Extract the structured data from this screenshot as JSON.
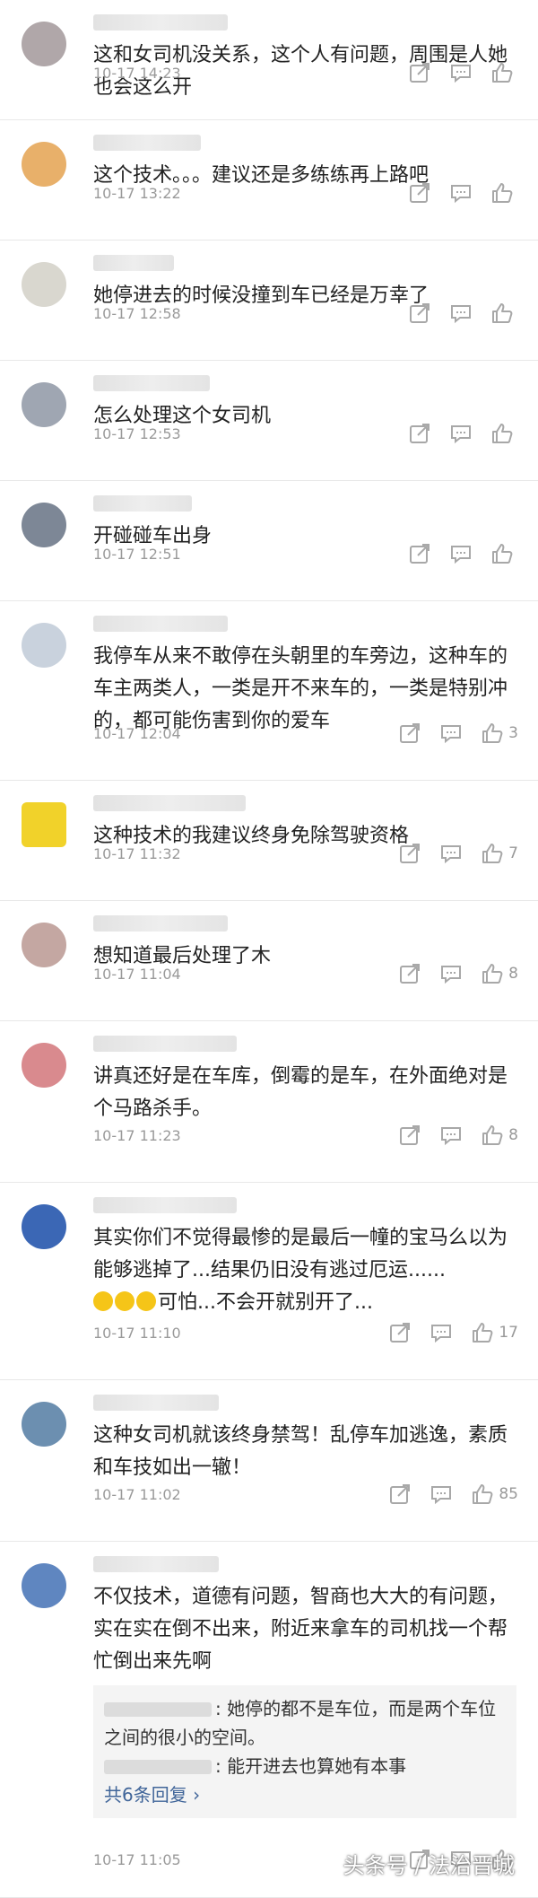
{
  "comments": [
    {
      "text": "这和女司机没关系，这个人有问题，周围是人她也会这么开",
      "time": "10-17 14:23",
      "likes": "",
      "avatar": "#b0a7a9"
    },
    {
      "text": "这个技术。。。建议还是多练练再上路吧",
      "time": "10-17 13:22",
      "likes": "",
      "avatar": "#e8b06a"
    },
    {
      "text": "她停进去的时候没撞到车已经是万幸了",
      "time": "10-17 12:58",
      "likes": "",
      "avatar": "#d9d7cf"
    },
    {
      "text": "怎么处理这个女司机",
      "time": "10-17 12:53",
      "likes": "",
      "avatar": "#9fa6b2"
    },
    {
      "text": "开碰碰车出身",
      "time": "10-17 12:51",
      "likes": "",
      "avatar": "#7d8796"
    },
    {
      "text": "我停车从来不敢停在头朝里的车旁边，这种车的车主两类人，一类是开不来车的，一类是特别冲的，都可能伤害到你的爱车",
      "time": "10-17 12:04",
      "likes": "3",
      "avatar": "#c9d2dd"
    },
    {
      "text": "这种技术的我建议终身免除驾驶资格",
      "time": "10-17 11:32",
      "likes": "7",
      "avatar": "#f1d22a"
    },
    {
      "text": "想知道最后处理了木",
      "time": "10-17 11:04",
      "likes": "8",
      "avatar": "#c4a7a2"
    },
    {
      "text": "讲真还好是在车库，倒霉的是车，在外面绝对是个马路杀手。",
      "time": "10-17 11:23",
      "likes": "8",
      "avatar": "#d98a8e"
    },
    {
      "text": "其实你们不觉得最惨的是最后一幢的宝马么以为能够逃掉了...结果仍旧没有逃过厄运......",
      "text2": "可怕...不会开就别开了...",
      "time": "10-17 11:10",
      "likes": "17",
      "avatar": "#3b67b5"
    },
    {
      "text": "这种女司机就该终身禁驾！乱停车加逃逸，素质和车技如出一辙！",
      "time": "10-17 11:02",
      "likes": "85",
      "avatar": "#6c8fb0"
    },
    {
      "text": "不仅技术，道德有问题，智商也大大的有问题，实在实在倒不出来，附近来拿车的司机找一个帮忙倒出来先啊",
      "time": "10-17 11:05",
      "likes": "",
      "avatar": "#5f86c0"
    }
  ],
  "replies": [
    {
      "text": ": 她停的都不是车位，而是两个车位之间的很小的空间。"
    },
    {
      "text": ": 能开进去也算她有本事"
    }
  ],
  "more_replies": "共6条回复 ›",
  "watermark": "头条号 / 法治晋城",
  "icons": {
    "share": "share-icon",
    "comment": "comment-icon",
    "like": "thumbs-up-icon"
  }
}
